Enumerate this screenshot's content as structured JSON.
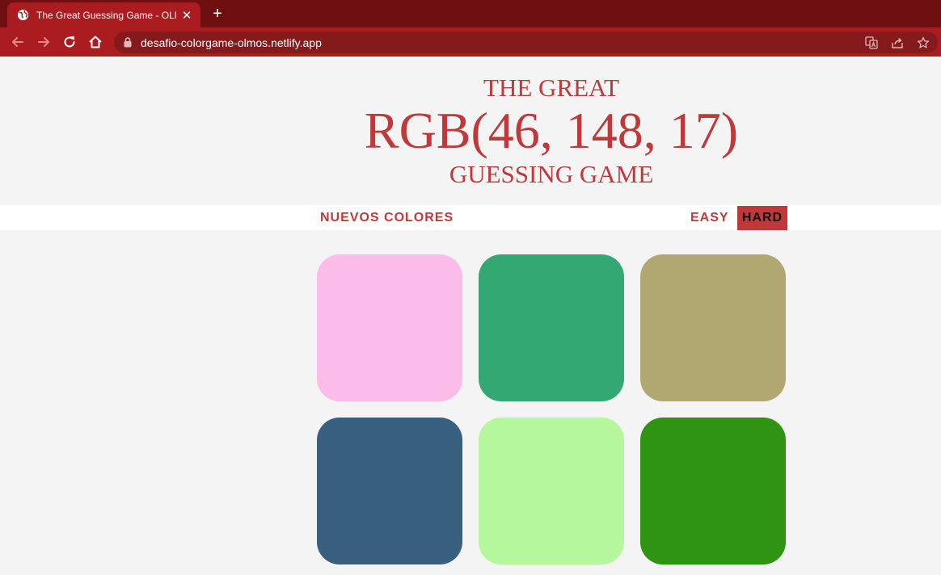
{
  "browser": {
    "tab_title": "The Great Guessing Game - OLMOS",
    "new_tab_label": "+",
    "tab_close": "✕",
    "url": "desafio-colorgame-olmos.netlify.app"
  },
  "header": {
    "line1": "THE GREAT",
    "rgb": "RGB(46, 148, 17)",
    "line3": "GUESSING GAME"
  },
  "controls": {
    "new_colors": "NUEVOS COLORES",
    "easy": "EASY",
    "hard": "HARD",
    "selected_mode": "HARD"
  },
  "colors": {
    "accent": "#c1383a",
    "tabbar": "#6e0f12",
    "toolbar": "#aa1c20"
  },
  "squares": [
    {
      "color": "#fbbce9"
    },
    {
      "color": "#33a873"
    },
    {
      "color": "#b0a870"
    },
    {
      "color": "#38607e"
    },
    {
      "color": "#b5f79c"
    },
    {
      "color": "#2e9411"
    }
  ]
}
